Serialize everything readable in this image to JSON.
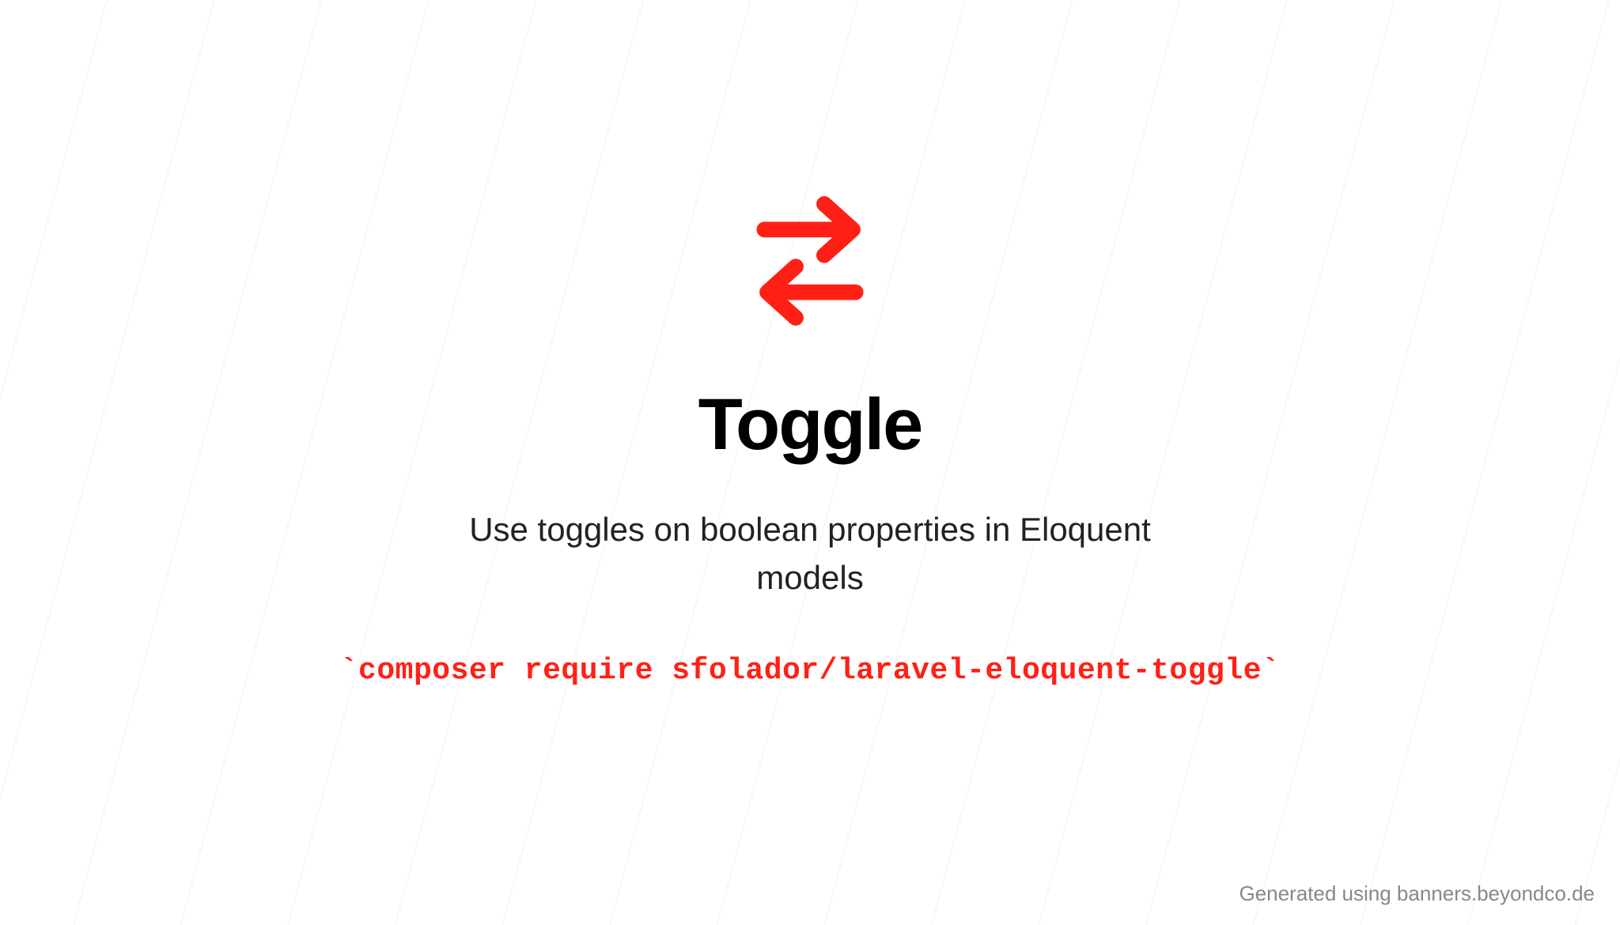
{
  "banner": {
    "title": "Toggle",
    "subtitle": "Use toggles on boolean properties in Eloquent models",
    "command": "`composer require sfolador/laravel-eloquent-toggle`",
    "icon_name": "swap-arrows",
    "accent_color": "#ff2015"
  },
  "attribution": "Generated using banners.beyondco.de"
}
